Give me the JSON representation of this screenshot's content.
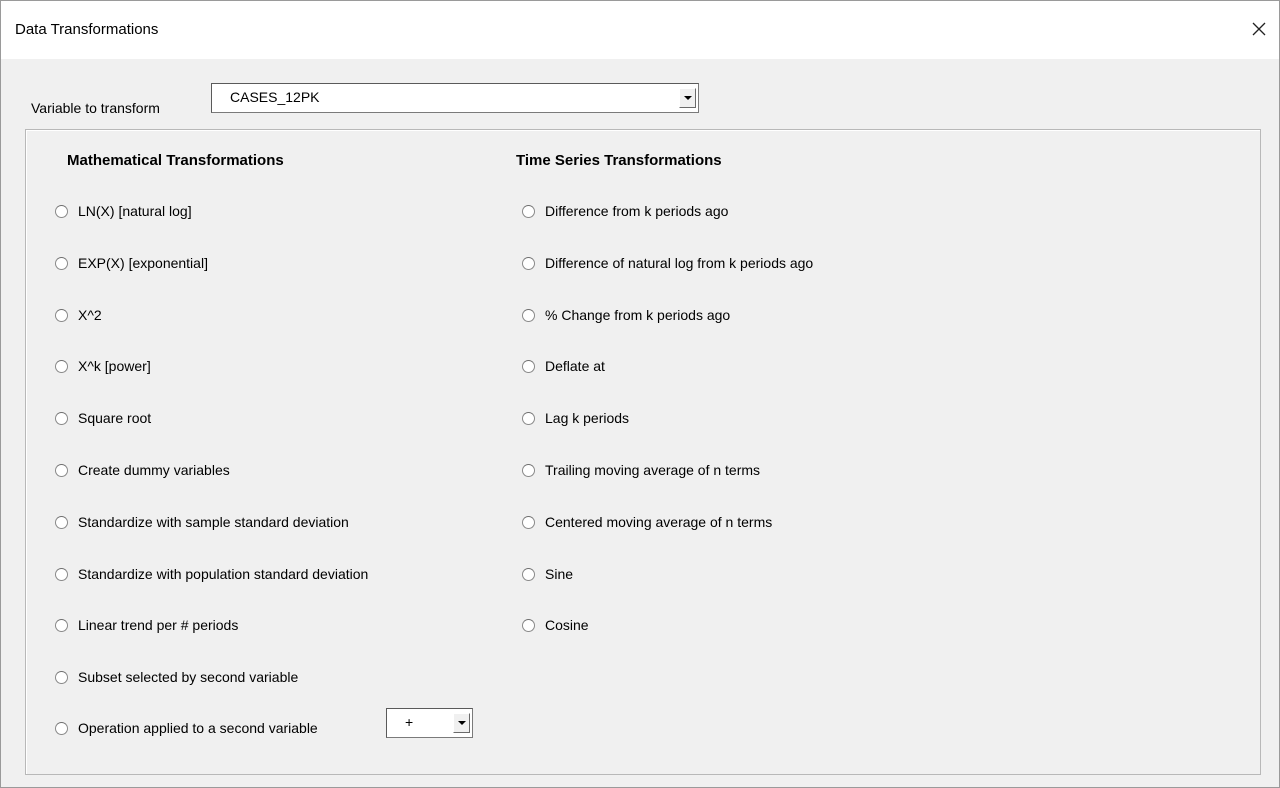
{
  "window": {
    "title": "Data Transformations",
    "close_icon": "close-icon"
  },
  "variable": {
    "label": "Variable to transform",
    "value": "CASES_12PK"
  },
  "math": {
    "header": "Mathematical Transformations",
    "options": [
      "LN(X)  [natural log]",
      "EXP(X)  [exponential]",
      "X^2",
      "X^k  [power]",
      "Square root",
      "Create dummy variables",
      "Standardize with sample standard deviation",
      "Standardize with population standard deviation",
      "Linear trend per # periods",
      "Subset selected by second variable",
      "Operation applied to a second variable"
    ],
    "operation_value": "+"
  },
  "timeseries": {
    "header": "Time Series Transformations",
    "options": [
      "Difference from k periods ago",
      "Difference of natural log from k periods ago",
      "% Change from k periods ago",
      "Deflate at",
      "Lag k periods",
      "Trailing moving average of n terms",
      "Centered moving average of n terms",
      "Sine",
      "Cosine"
    ]
  }
}
